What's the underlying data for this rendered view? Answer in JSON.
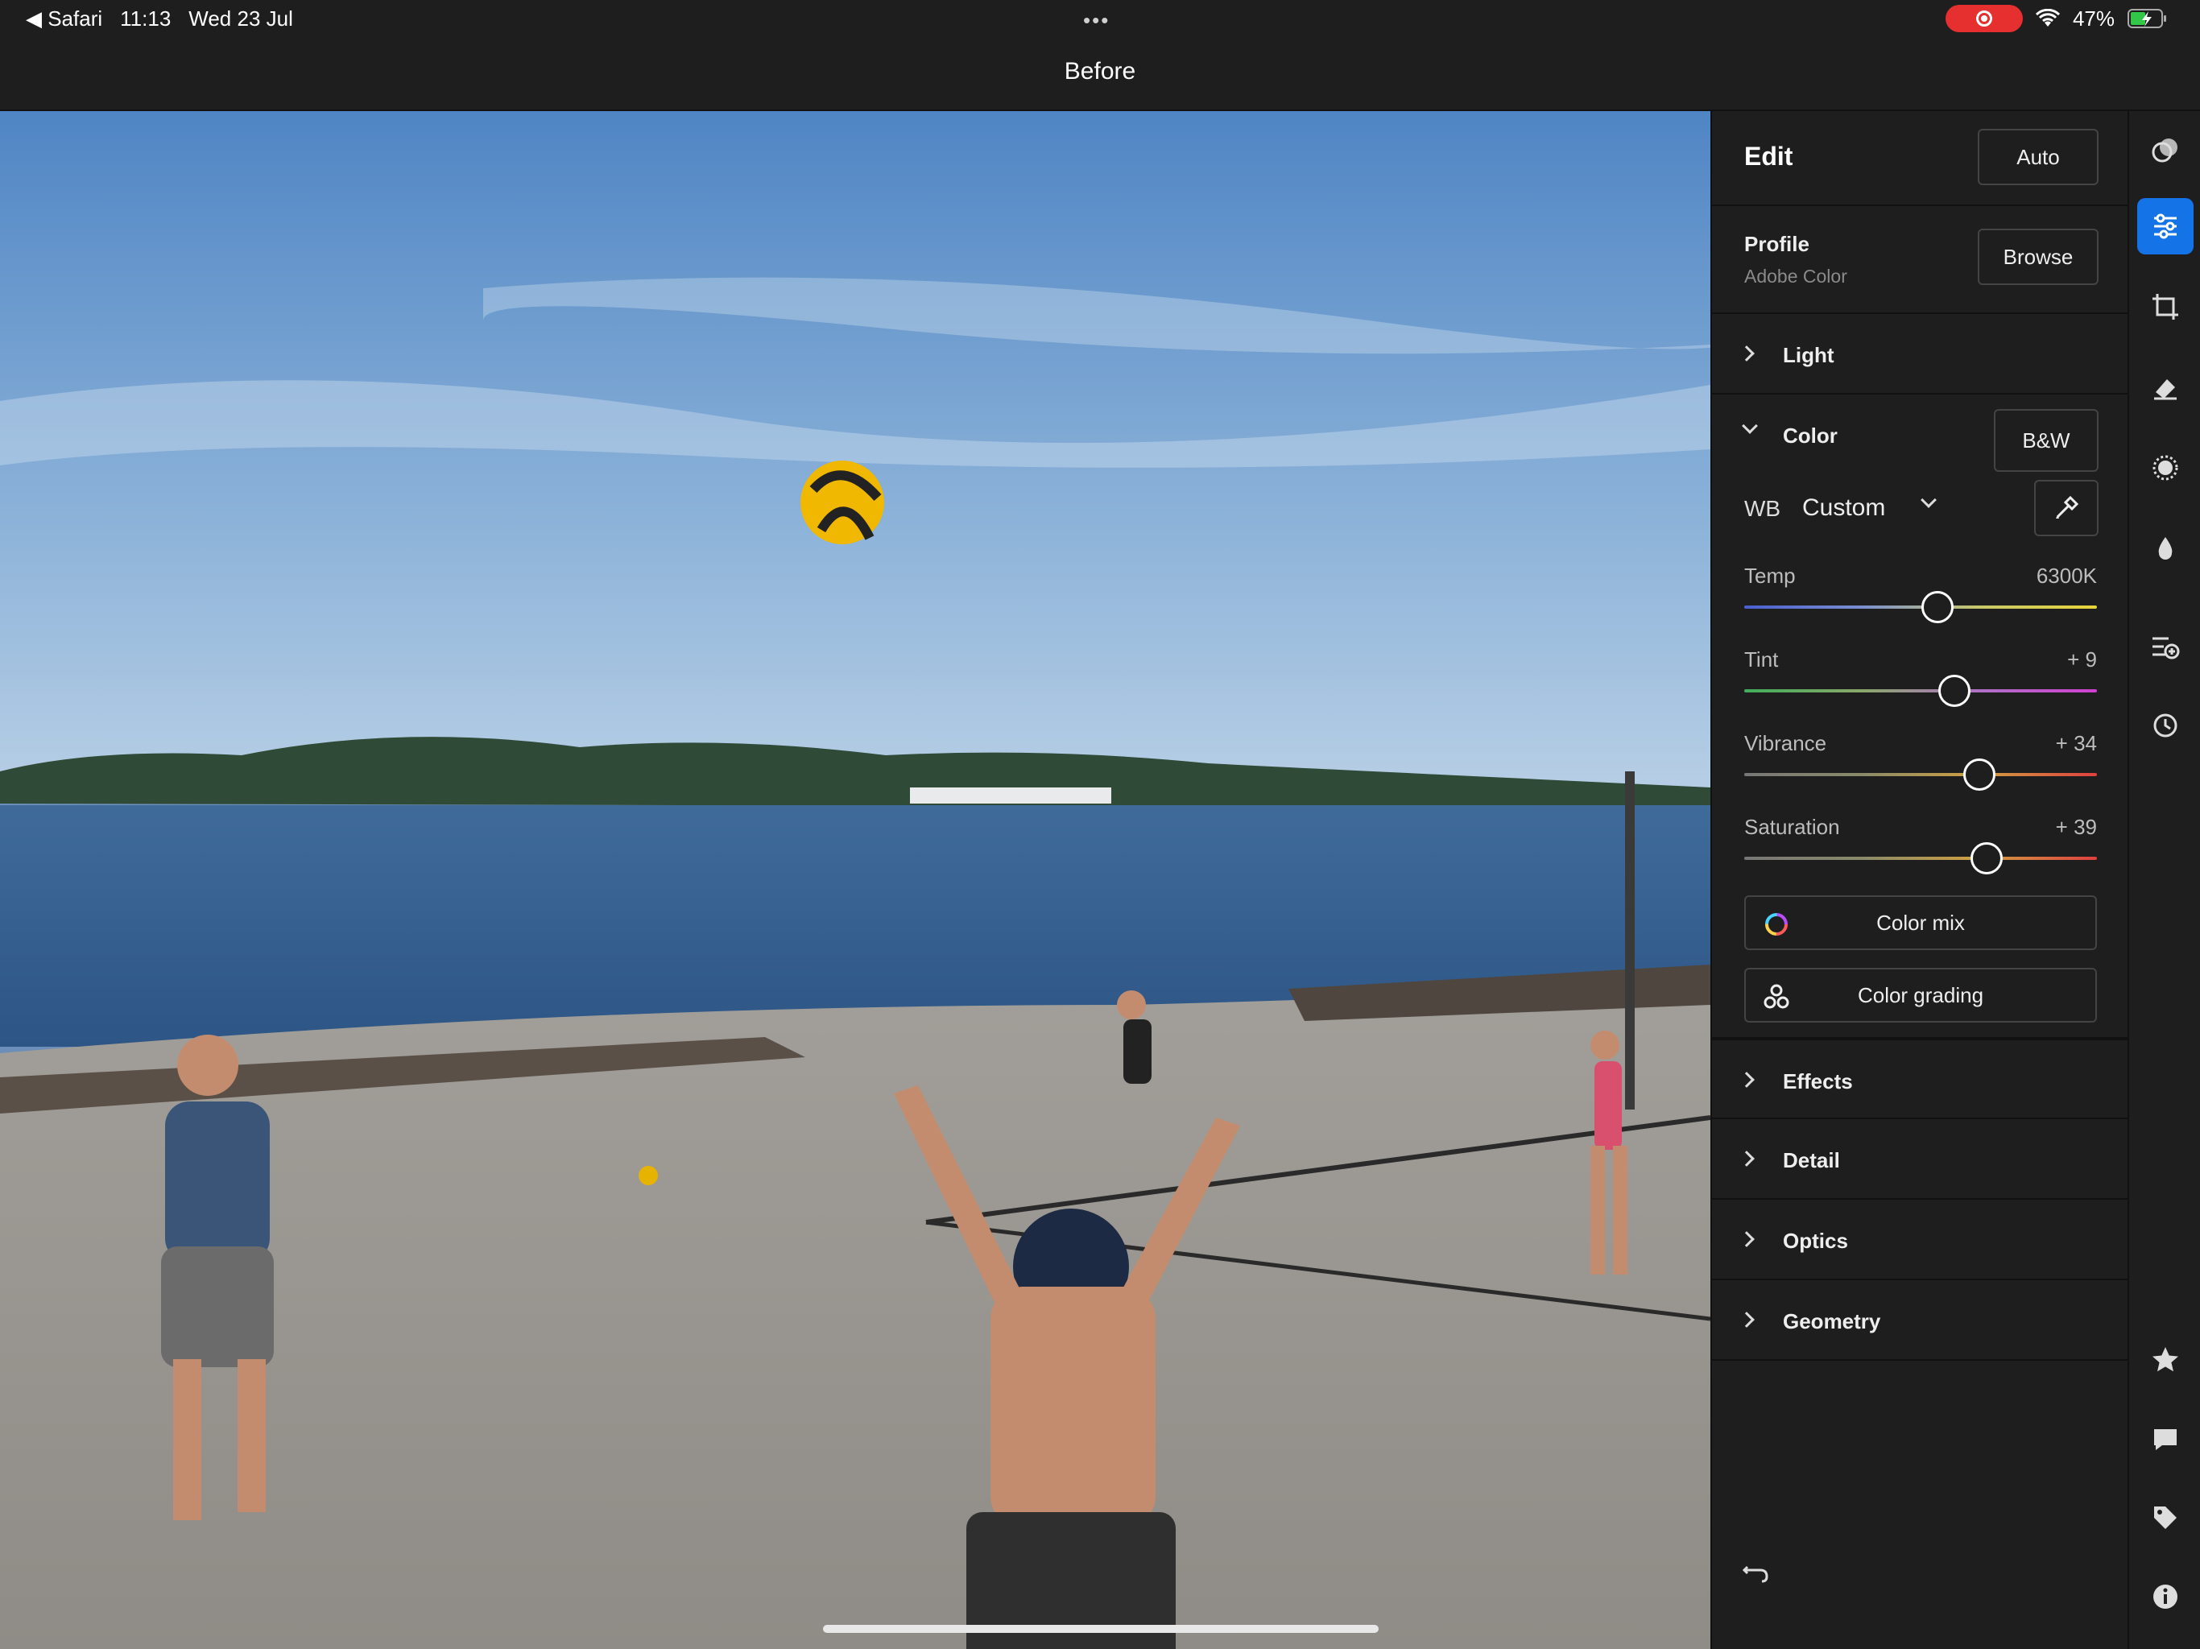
{
  "status_bar": {
    "back_app": "◀ Safari",
    "time": "11:13",
    "date": "Wed 23 Jul",
    "battery": "47%"
  },
  "title_bar": {
    "title": "Before"
  },
  "edit_panel": {
    "title": "Edit",
    "auto_label": "Auto",
    "profile": {
      "label": "Profile",
      "value": "Adobe Color",
      "browse_label": "Browse"
    },
    "sections": {
      "light": "Light",
      "color": "Color",
      "effects": "Effects",
      "detail": "Detail",
      "optics": "Optics",
      "geometry": "Geometry"
    },
    "bw_label": "B&W",
    "wb": {
      "label": "WB",
      "value": "Custom"
    },
    "sliders": [
      {
        "label": "Temp",
        "value": "6300K",
        "position": 0.25
      },
      {
        "label": "Tint",
        "value": "+ 9",
        "position": 0.3
      },
      {
        "label": "Vibrance",
        "value": "+ 34",
        "position": 0.37
      },
      {
        "label": "Saturation",
        "value": "+ 39",
        "position": 0.39
      }
    ],
    "color_mix_label": "Color mix",
    "color_grading_label": "Color grading"
  },
  "toolbar": {
    "tools": [
      "presets-icon",
      "edit-sliders-icon",
      "crop-icon",
      "healing-icon",
      "masking-icon",
      "blur-icon",
      "versions-icon",
      "history-icon",
      "rating-icon",
      "comment-icon",
      "tag-icon",
      "info-icon"
    ],
    "active_tool": "edit-sliders-icon"
  },
  "colors": {
    "accent": "#1473e6",
    "panel_bg": "#1e1e1f",
    "record": "#e5302f"
  }
}
